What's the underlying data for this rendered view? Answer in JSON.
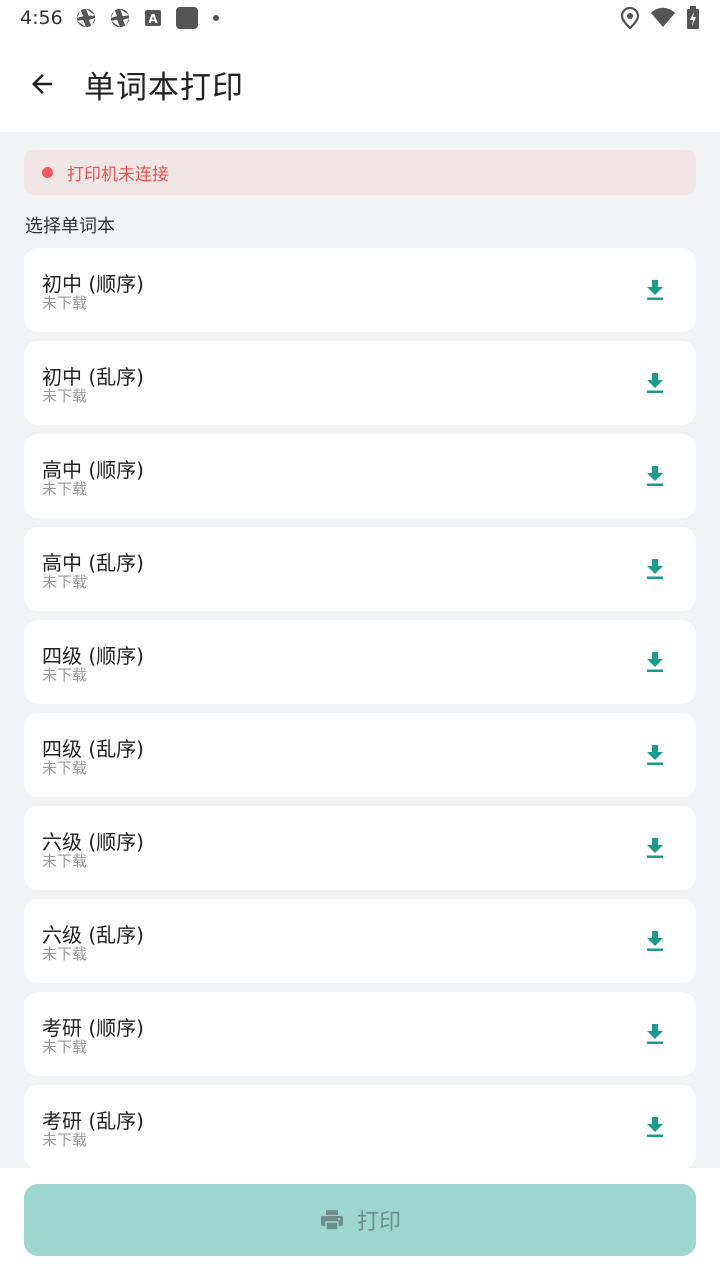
{
  "status_bar": {
    "time": "4:56",
    "left_icons": [
      "shutter-icon",
      "shutter-icon",
      "a-square-icon",
      "square-icon",
      "dot-icon"
    ],
    "right_icons": [
      "location-icon",
      "wifi-icon",
      "battery-charging-icon"
    ]
  },
  "header": {
    "back_icon": "arrow-left-icon",
    "title": "单词本打印"
  },
  "alert": {
    "text": "打印机未连接",
    "color": "#ef5350",
    "background": "#f2e5e6"
  },
  "section": {
    "label": "选择单词本"
  },
  "wordbooks": [
    {
      "name": "初中 (顺序)",
      "status": "未下载"
    },
    {
      "name": "初中 (乱序)",
      "status": "未下载"
    },
    {
      "name": "高中 (顺序)",
      "status": "未下载"
    },
    {
      "name": "高中 (乱序)",
      "status": "未下载"
    },
    {
      "name": "四级 (顺序)",
      "status": "未下载"
    },
    {
      "name": "四级 (乱序)",
      "status": "未下载"
    },
    {
      "name": "六级 (顺序)",
      "status": "未下载"
    },
    {
      "name": "六级 (乱序)",
      "status": "未下载"
    },
    {
      "name": "考研 (顺序)",
      "status": "未下载"
    },
    {
      "name": "考研 (乱序)",
      "status": "未下载"
    }
  ],
  "download_icon": "download-icon",
  "accent_color": "#1a9b8c",
  "print_button": {
    "label": "打印",
    "icon": "printer-icon",
    "background": "#9dd5cf"
  }
}
